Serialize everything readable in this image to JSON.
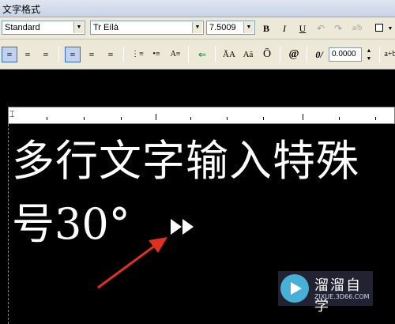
{
  "window": {
    "title": "文字格式"
  },
  "toolbar": {
    "style": {
      "value": "Standard"
    },
    "font": {
      "value": "Tr Eílà"
    },
    "height": {
      "value": "7.5009"
    },
    "bold": "B",
    "italic": "I",
    "underline": "U",
    "stack": "a/b",
    "oblique": "0/",
    "oblique_value": "0.0000",
    "case_upper": "ĂA",
    "case_lower": "Aă",
    "overline": "Ō",
    "symbol": "@",
    "tracking": "a+b"
  },
  "editor": {
    "line1": "多行文字输入特殊",
    "line2": "号30°"
  },
  "watermark": {
    "name": "溜溜自学",
    "url": "ZIXUE.3D66.COM"
  },
  "colors": {
    "toolbar_bg": "#ece9d8",
    "canvas_bg": "#000000",
    "text": "#ffffff",
    "arrow": "#e03020"
  }
}
